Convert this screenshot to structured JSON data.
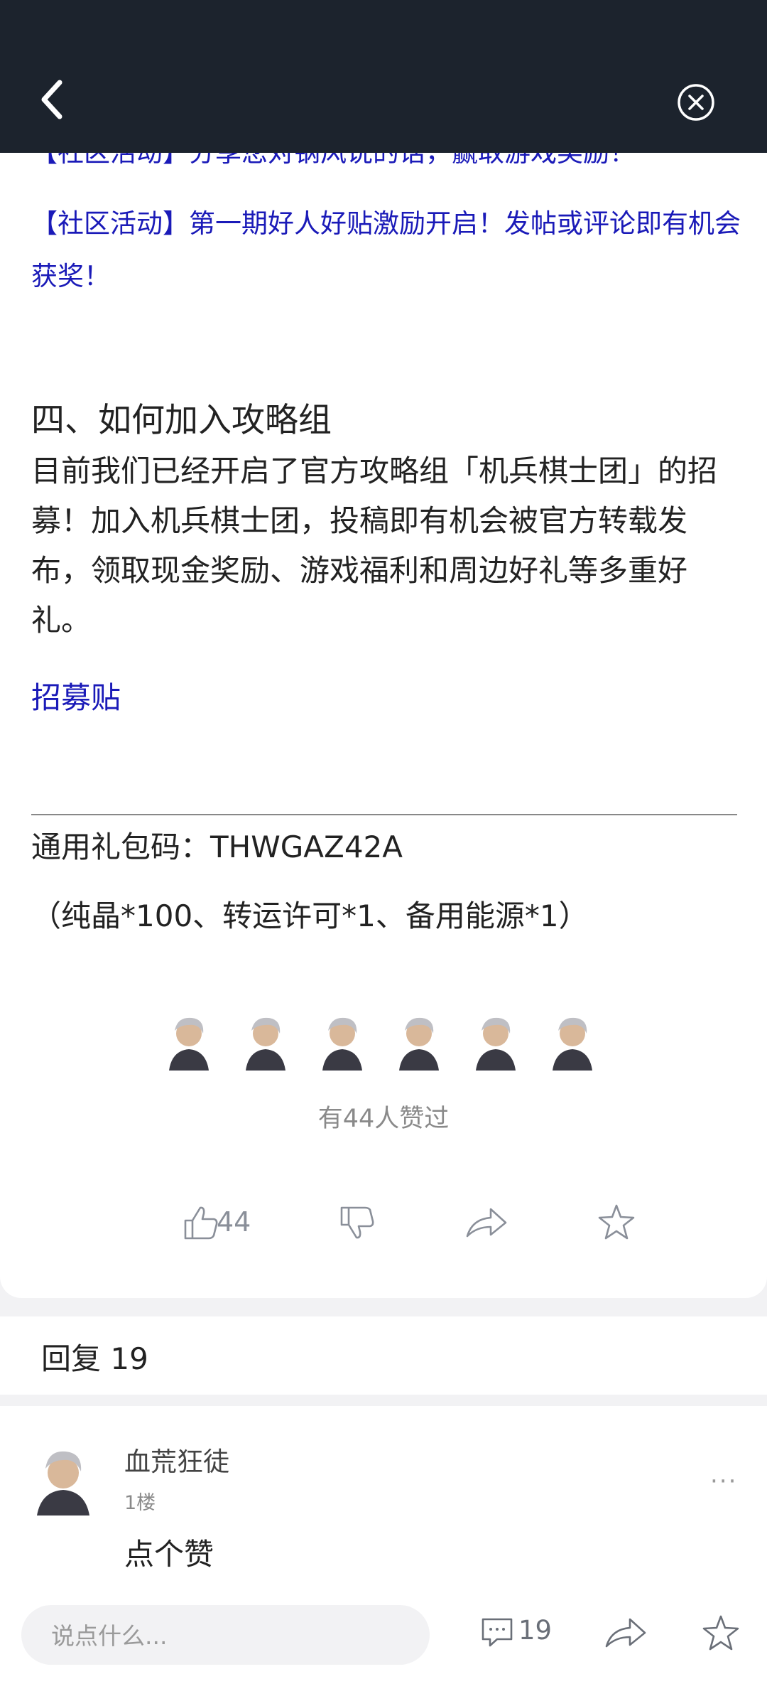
{
  "header": {
    "back_icon": "chevron-left-icon",
    "close_icon": "close-circle-icon"
  },
  "article": {
    "cut_link": "【社区活动】分享您对钢风说的话，赢取游戏奖励！",
    "event_link": "【社区活动】第一期好人好贴激励开启！发帖或评论即有机会获奖！",
    "section_title": "四、如何加入攻略组",
    "body": "目前我们已经开启了官方攻略组「机兵棋士团」的招募！加入机兵棋士团，投稿即有机会被官方转载发布，领取现金奖励、游戏福利和周边好礼等多重好礼。",
    "recruit_link": "招募贴",
    "gift_code": "通用礼包码：THWGAZ42A",
    "gift_items": "（纯晶*100、转运许可*1、备用能源*1）",
    "likes_summary": "有44人赞过",
    "like_count": "44"
  },
  "replies": {
    "label": "回复 19"
  },
  "comment": {
    "user": "血荒狂徒",
    "floor": "1楼",
    "text": "点个赞",
    "more": "···"
  },
  "bottom_bar": {
    "placeholder": "说点什么...",
    "comment_count": "19"
  },
  "colors": {
    "header_bg": "#1c232d",
    "link": "#1a1ab8",
    "icon_gray": "#8a8f99"
  }
}
